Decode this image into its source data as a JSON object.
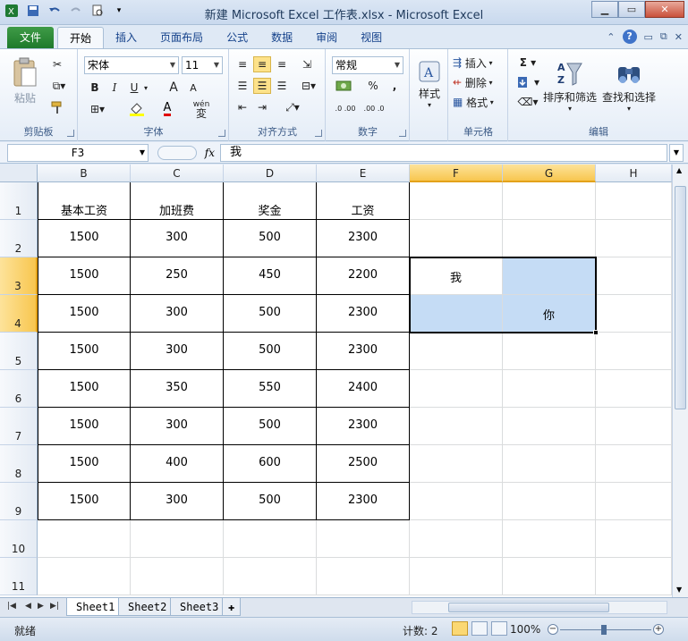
{
  "window": {
    "title": "新建 Microsoft Excel 工作表.xlsx  -  Microsoft Excel"
  },
  "ribbon_tabs": [
    "文件",
    "开始",
    "插入",
    "页面布局",
    "公式",
    "数据",
    "审阅",
    "视图"
  ],
  "ribbon": {
    "clipboard": {
      "paste": "粘贴",
      "label": "剪贴板"
    },
    "font": {
      "name": "宋体",
      "size": "11",
      "label": "字体",
      "bold": "B",
      "italic": "I",
      "underline": "U",
      "grow": "A",
      "shrink": "A",
      "font_color": "A",
      "wen": "wén",
      "wen2": "変"
    },
    "alignment": {
      "label": "对齐方式"
    },
    "number": {
      "format": "常规",
      "label": "数字",
      "percent": "%",
      "comma": ",",
      "inc_dec": ".0 .00",
      "dec_dec": ".00 .0"
    },
    "styles": {
      "label": "样式"
    },
    "cells": {
      "insert": "插入",
      "delete": "删除",
      "format": "格式",
      "label": "单元格"
    },
    "editing": {
      "sort_filter": "排序和筛选",
      "find_select": "查找和选择",
      "label": "编辑"
    }
  },
  "formula_bar": {
    "name_box": "F3",
    "fx": "fx",
    "content": "我"
  },
  "columns": [
    "B",
    "C",
    "D",
    "E",
    "F",
    "G",
    "H"
  ],
  "rows": [
    "1",
    "2",
    "3",
    "4",
    "5",
    "6",
    "7",
    "8",
    "9",
    "10",
    "11"
  ],
  "table": {
    "headers": [
      "基本工资",
      "加班费",
      "奖金",
      "工资"
    ],
    "data": [
      [
        "1500",
        "300",
        "500",
        "2300"
      ],
      [
        "1500",
        "250",
        "450",
        "2200"
      ],
      [
        "1500",
        "300",
        "500",
        "2300"
      ],
      [
        "1500",
        "300",
        "500",
        "2300"
      ],
      [
        "1500",
        "350",
        "550",
        "2400"
      ],
      [
        "1500",
        "300",
        "500",
        "2300"
      ],
      [
        "1500",
        "400",
        "600",
        "2500"
      ],
      [
        "1500",
        "300",
        "500",
        "2300"
      ]
    ]
  },
  "selection_cells": {
    "F3": "我",
    "G4": "你"
  },
  "sheet_tabs": [
    "Sheet1",
    "Sheet2",
    "Sheet3"
  ],
  "status_bar": {
    "mode": "就绪",
    "count": "计数: 2",
    "zoom": "100%"
  },
  "colors": {
    "selection": "#c5dcf5",
    "accent_file": "#1e7a2b",
    "header_selected": "#f8c64f"
  }
}
